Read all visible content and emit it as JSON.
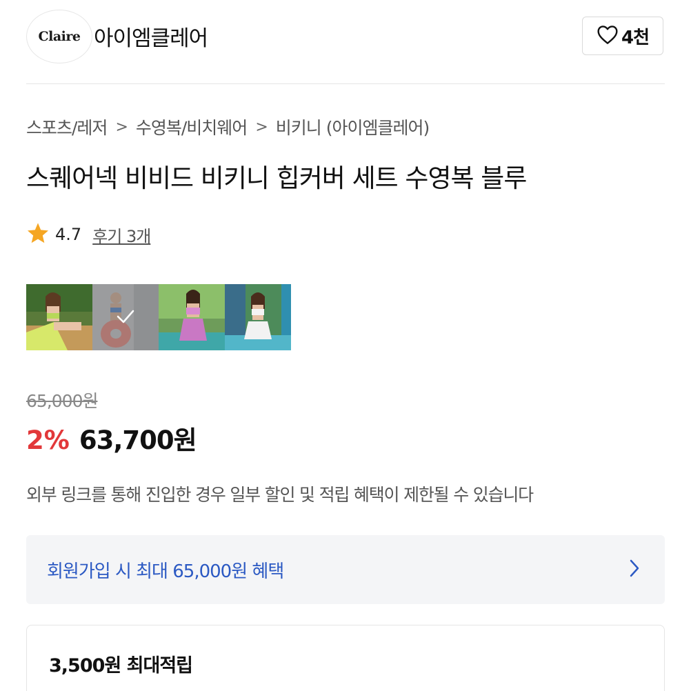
{
  "shop": {
    "logo_text": "Claire",
    "name": "아이엠클레어",
    "like_count": "4천"
  },
  "breadcrumb": [
    "스포츠/레저",
    "수영복/비치웨어",
    "비키니 (아이엠클레어)"
  ],
  "product": {
    "title": "스퀘어넥 비비드 비키니 힙커버 세트 수영복 블루",
    "rating": "4.7",
    "review_link": "후기 3개"
  },
  "thumbnails": [
    {
      "name": "thumbnail-1",
      "selected": false
    },
    {
      "name": "thumbnail-2",
      "selected": true
    },
    {
      "name": "thumbnail-3",
      "selected": false
    },
    {
      "name": "thumbnail-4",
      "selected": false
    }
  ],
  "price": {
    "original": "65,000원",
    "discount": "2%",
    "final": "63,700원"
  },
  "notice": "외부 링크를 통해 진입한 경우 일부 할인 및 적립 혜택이 제한될 수 있습니다",
  "benefit": {
    "text": "회원가입 시 최대 65,000원 혜택"
  },
  "points": {
    "text": "3,500원 최대적립"
  },
  "colors": {
    "discount": "#e2383a",
    "benefit": "#2b59c3",
    "star": "#f5a623"
  },
  "icons": [
    "heart-icon",
    "chevron-right-icon",
    "star-icon",
    "check-icon"
  ]
}
